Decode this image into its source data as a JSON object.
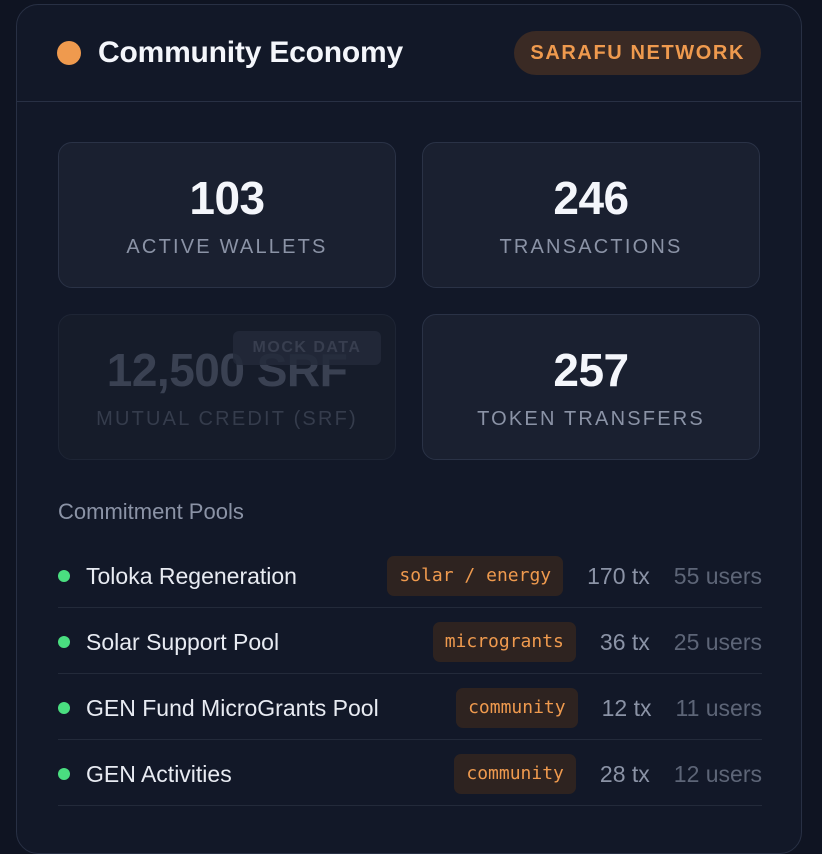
{
  "header": {
    "title": "Community Economy",
    "badge": "SARAFU NETWORK",
    "dot_color": "#ef9a4e",
    "badge_color": "#ef9a4e"
  },
  "stats": [
    {
      "value": "103",
      "label": "ACTIVE WALLETS"
    },
    {
      "value": "246",
      "label": "TRANSACTIONS"
    },
    {
      "value": "12,500 SRF",
      "label": "MUTUAL CREDIT (SRF)",
      "badge": "MOCK DATA"
    },
    {
      "value": "257",
      "label": "TOKEN TRANSFERS"
    }
  ],
  "pools": {
    "heading": "Commitment Pools",
    "dot_color": "#4ade80",
    "tag_color": "#ef9a4e",
    "items": [
      {
        "name": "Toloka Regeneration",
        "tag": "solar / energy",
        "tx": "170 tx",
        "users": "55 users"
      },
      {
        "name": "Solar Support Pool",
        "tag": "micrograntѕ",
        "tx": "36 tx",
        "users": "25 users"
      },
      {
        "name": "GEN Fund MicroGrants Pool",
        "tag": "community",
        "tx": "12 tx",
        "users": "11 users"
      },
      {
        "name": "GEN Activities",
        "tag": "community",
        "tx": "28 tx",
        "users": "12 users"
      }
    ]
  }
}
